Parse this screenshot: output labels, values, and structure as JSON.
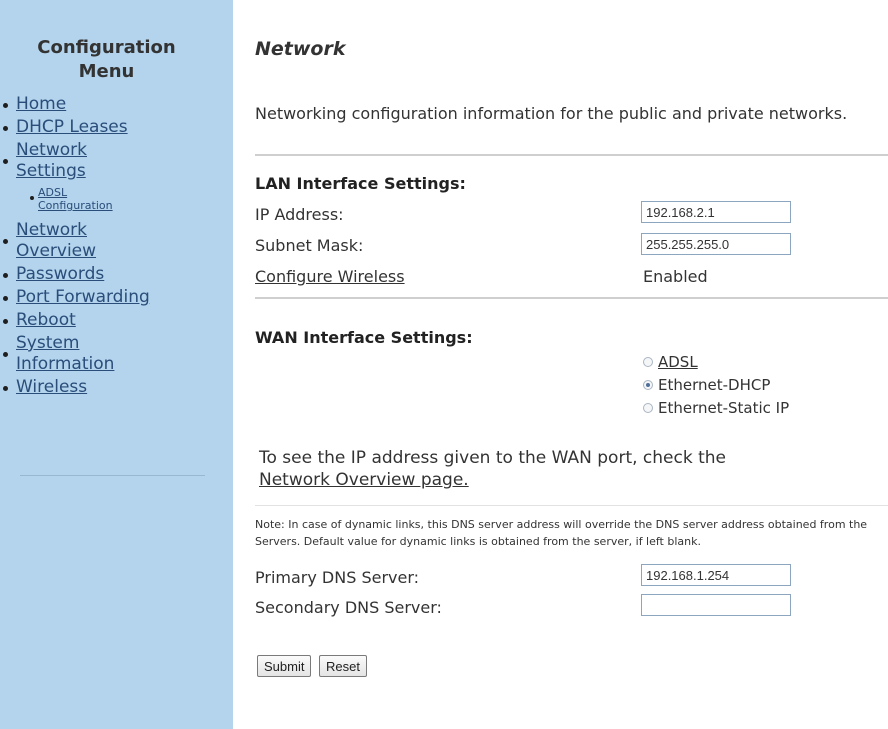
{
  "sidebar": {
    "title_line1": "Configuration",
    "title_line2": "Menu",
    "items": [
      {
        "label": "Home"
      },
      {
        "label": "DHCP Leases"
      },
      {
        "label_line1": "Network",
        "label_line2": "Settings"
      },
      {
        "label_line1": "ADSL",
        "label_line2": "Configuration"
      },
      {
        "label_line1": "Network",
        "label_line2": "Overview"
      },
      {
        "label": "Passwords"
      },
      {
        "label": "Port Forwarding"
      },
      {
        "label": "Reboot"
      },
      {
        "label_line1": "System",
        "label_line2": "Information"
      },
      {
        "label": "Wireless"
      }
    ]
  },
  "main": {
    "title": "Network",
    "description": "Networking configuration information for the public and private networks.",
    "lan": {
      "heading": "LAN Interface Settings:",
      "ip_label": "IP Address:",
      "ip_value": "192.168.2.1",
      "subnet_label": "Subnet Mask:",
      "subnet_value": "255.255.255.0",
      "wireless_link": "Configure Wireless",
      "wireless_status": "Enabled"
    },
    "wan": {
      "heading": "WAN Interface Settings:",
      "options": [
        {
          "label": "ADSL",
          "selected": false
        },
        {
          "label": "Ethernet-DHCP",
          "selected": true
        },
        {
          "label": "Ethernet-Static IP",
          "selected": false
        }
      ],
      "note_text": "To see the IP address given to the WAN port, check the",
      "note_link": "Network Overview page."
    },
    "dns": {
      "note": "Note: In case of dynamic links, this DNS server address will override the DNS server address obtained from the Servers. Default value for dynamic links is obtained from the server, if left blank.",
      "primary_label": "Primary DNS Server:",
      "primary_value": "192.168.1.254",
      "secondary_label": "Secondary DNS Server:",
      "secondary_value": ""
    },
    "buttons": {
      "submit": "Submit",
      "reset": "Reset"
    }
  }
}
